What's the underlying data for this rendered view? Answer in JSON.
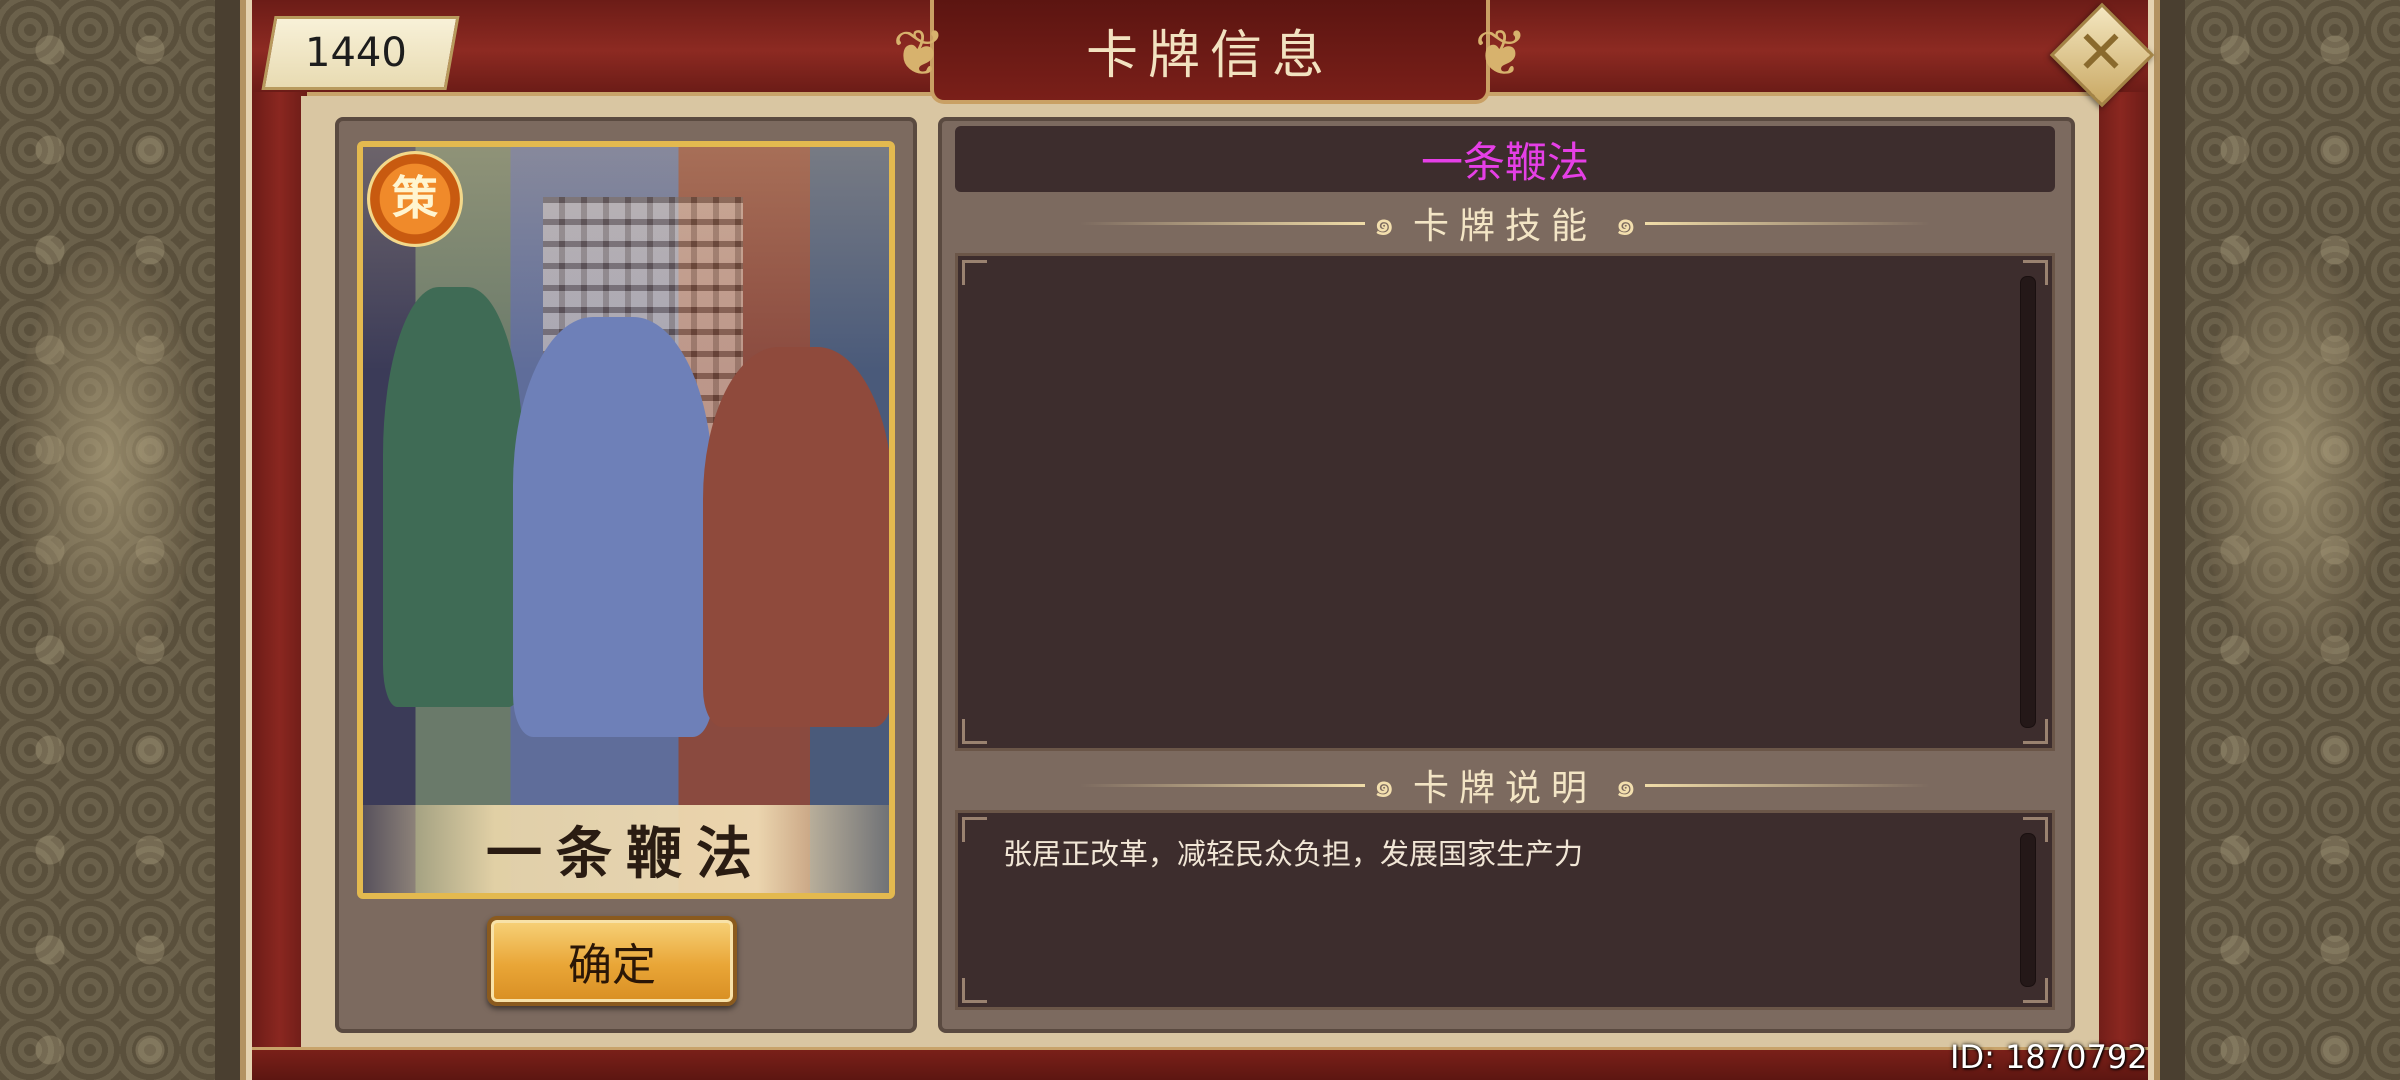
{
  "counter": {
    "value": "1440"
  },
  "dialog": {
    "title": "卡牌信息"
  },
  "card": {
    "badge": "策",
    "name": "一条鞭法"
  },
  "confirm_button": {
    "label": "确定"
  },
  "info": {
    "card_name": "一条鞭法",
    "skill_section": {
      "title": "卡牌技能",
      "text": ""
    },
    "description_section": {
      "title": "卡牌说明",
      "text": "张居正改革，减轻民众负担，发展国家生产力"
    }
  },
  "footer": {
    "id_text": "ID: 1870792"
  },
  "colors": {
    "card_name_color": "#e53fe6",
    "frame_red": "#7a1f19",
    "gold": "#e3b94f",
    "panel_bg": "#3d2d2d"
  },
  "icons": {
    "close": "close-icon",
    "badge": "strategy-badge-icon"
  }
}
